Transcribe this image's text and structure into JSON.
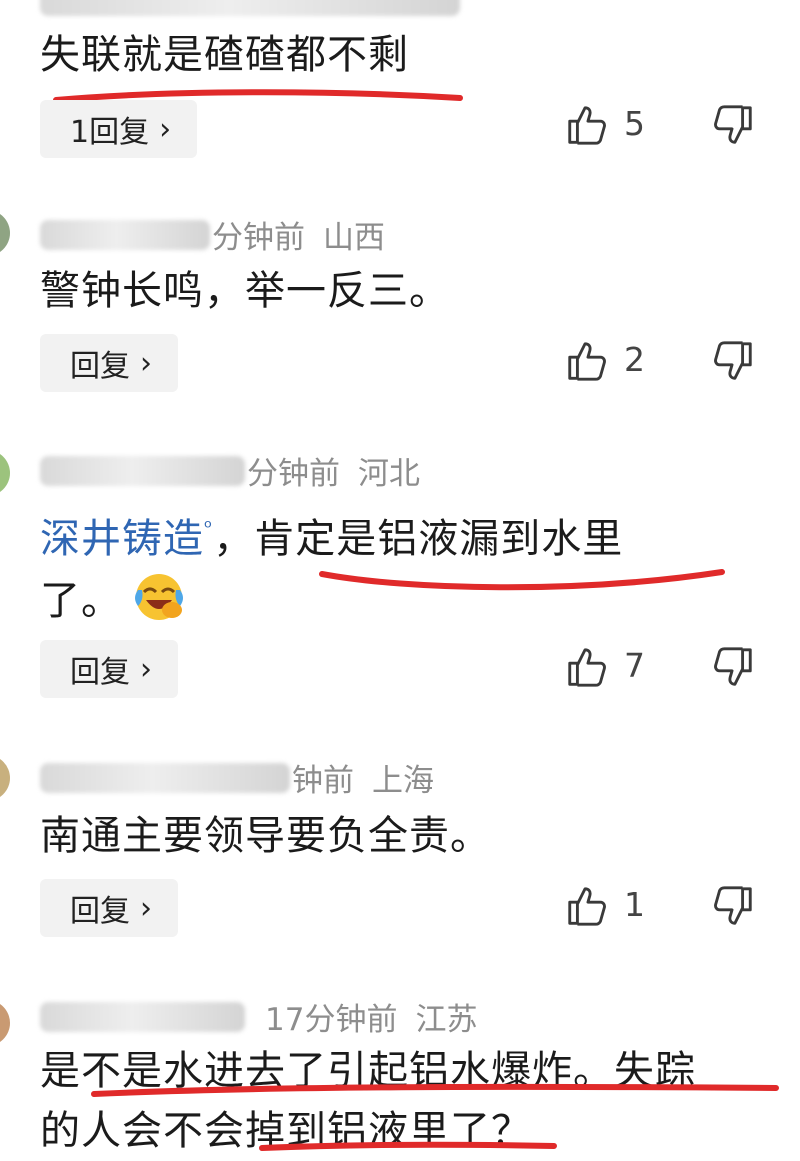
{
  "comments": [
    {
      "meta": {
        "name": "",
        "time": "",
        "location": ""
      },
      "text": "失联就是碴碴都不剩",
      "reply_label": "1回复",
      "likes": "5"
    },
    {
      "meta": {
        "name": "",
        "time": "分钟前",
        "location": "山西"
      },
      "text": "警钟长鸣，举一反三。",
      "reply_label": "回复",
      "likes": "2"
    },
    {
      "meta": {
        "name": "",
        "time": "分钟前",
        "location": "河北"
      },
      "mention": "深井铸造",
      "text_line1": "，肯定是铝液漏到水里",
      "text_line2": "了。",
      "reply_label": "回复",
      "likes": "7"
    },
    {
      "meta": {
        "name": "",
        "time": "钟前",
        "location": "上海"
      },
      "text": "南通主要领导要负全责。",
      "reply_label": "回复",
      "likes": "1"
    },
    {
      "meta": {
        "name": "",
        "time": "17分钟前",
        "location": "江苏"
      },
      "text_line1": "是不是水进去了引起铝水爆炸。失踪",
      "text_line2": "的人会不会掉到铝液里了？"
    }
  ],
  "icons": {
    "like": "thumb-up-icon",
    "dislike": "thumb-down-icon",
    "chevron": "chevron-right-icon",
    "search": "search-icon",
    "emoji": "laughing-crying-emoji-icon"
  },
  "colors": {
    "underline": "#e02a2a",
    "mention": "#2f66b3",
    "meta": "#8d8d8d",
    "reply_bg": "#f2f2f2"
  }
}
